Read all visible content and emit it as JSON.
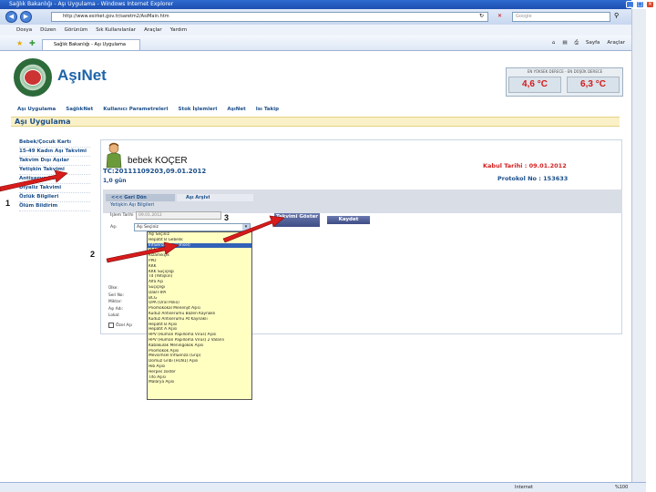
{
  "browser": {
    "window_title": "Sağlık Bakanlığı - Aşı Uygulama - Windows Internet Explorer",
    "url": "http://www.esirket.gov.tr/saretm2/AsiMain.htm",
    "search_placeholder": "Google",
    "menu": [
      "Dosya",
      "Düzen",
      "Görünüm",
      "Sık Kullanılanlar",
      "Araçlar",
      "Yardım"
    ],
    "tab_title": "Sağlık Bakanlığı - Aşı Uygulama",
    "tool_sayfa": "Sayfa",
    "tool_araclar": "Araçlar",
    "status_zone": "Internet",
    "zoom": "%100"
  },
  "header": {
    "brand": "AşıNet",
    "temp_label": "EN YÜKSEK DERECE - EN DÜŞÜK DERECE",
    "temp_max": "4,6 °C",
    "temp_min": "6,3 °C"
  },
  "nav": [
    "Aşı Uygulama",
    "SağlıkNet",
    "Kullanıcı Parametreleri",
    "Stok İşlemleri",
    "AşıNet",
    "Isı Takip"
  ],
  "section_title": "Aşı Uygulama",
  "left_menu": [
    "Bebek/Çocuk Kartı",
    "15-49 Kadın Aşı Takvimi",
    "Takvim Dışı Aşılar",
    "Yetişkin Takvimi",
    "Antiserumlar",
    "Diyaliz Takvimi",
    "Özlük Bilgileri",
    "Ölüm Bildirim"
  ],
  "patient": {
    "name": "bebek KOÇER",
    "tc_line": "TC:20111109203,09.01.2012",
    "age": "1,0 gün",
    "kabul": "Kabul Tarihi : 09.01.2012",
    "protokol": "Protokol No : 153633"
  },
  "tabs": {
    "back": "<<< Geri Dön",
    "archive": "Aşı Arşivi"
  },
  "form": {
    "subtitle": "Yetişkin Aşı Bilgileri",
    "date_label": "İşlem Tarihi",
    "date_value": "09.01.2012",
    "vaccine_label": "Aşı",
    "selected_value": "Aşı Seçiniz",
    "btn_takvim": "Takvimi Göster",
    "btn_kaydet": "Kaydet",
    "lower_labels": [
      "Ülke:",
      "Seri No:",
      "Miktar:",
      "Aşı Adı:",
      "Lokal:"
    ],
    "checkbox_label": "Özel Aşı"
  },
  "dropdown_items": [
    "Aşı Seçiniz",
    "Hepatit B Gebelik",
    "Influenza(Mevsimsel)",
    "BCG",
    "Kızamıkçık",
    "PPD",
    "KKK",
    "KKK Suçiçeği",
    "Td (Yetişkin)",
    "Alfa Aşı",
    "Suçiçeği",
    "DaBT-İPA",
    "BCG",
    "OPA (Oral Polio)",
    "Pnömokokal Menenjit Aşısı",
    "Kuduz Antiserumu Bazen Kaynaklı",
    "Kuduz Antiserumu At Kaynaklı",
    "Hepatit B Aşısı",
    "Hepatit A Aşısı",
    "HPV (Human Papilloma Virüs) Aşısı",
    "HPV (Human Papilloma Virüs) 2 Valanlı",
    "Kabakulak Meningokok Aşısı",
    "Pnömokok Aşısı",
    "Mevsimsel İnfluenza (Grip)",
    "Domuz Gribi (H1N1) Aşısı",
    "Hib Aşısı",
    "Herpes zoster",
    "Tifo Aşısı",
    "Malarya Aşısı"
  ],
  "annotations": {
    "step1": "1",
    "step2": "2",
    "step3": "3"
  },
  "colors": {
    "brand": "#1e64a8",
    "arrow": "#d81b1b",
    "selected_item": "#3162b7",
    "dropdown_bg": "#ffffc2"
  }
}
